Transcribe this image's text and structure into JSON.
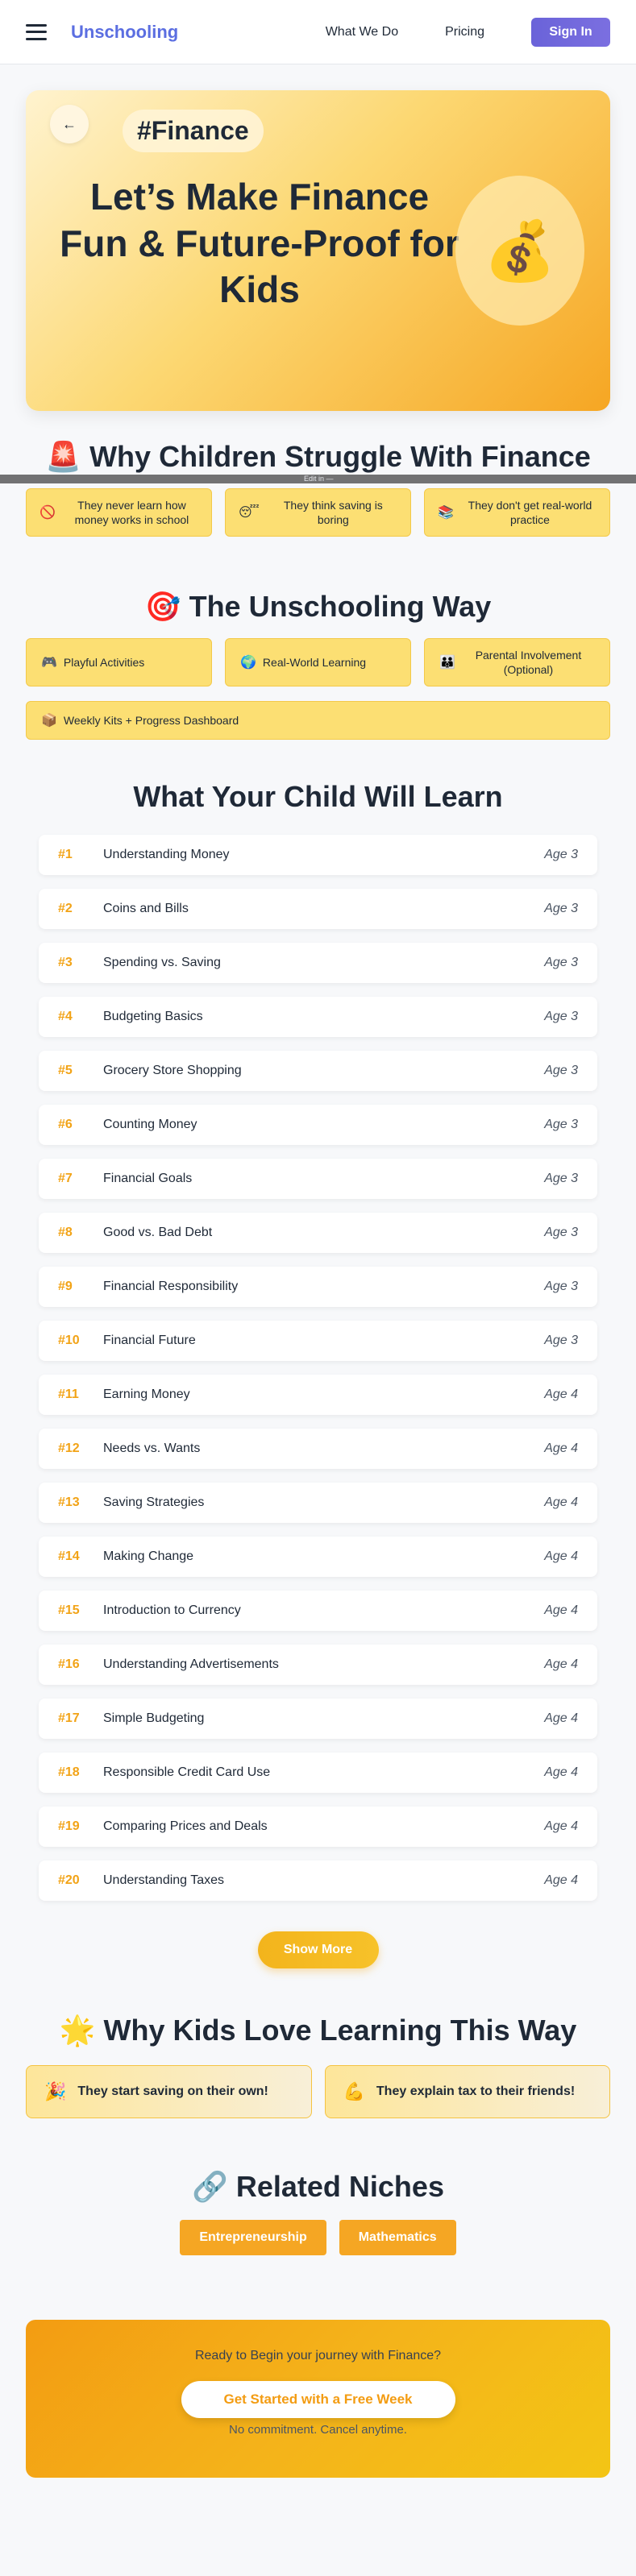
{
  "header": {
    "logo": "Unschooling",
    "nav": [
      "What We Do",
      "Pricing"
    ],
    "signin": "Sign In"
  },
  "hero": {
    "back_icon": "arrow-left-icon",
    "tag": "#Finance",
    "title": "Let’s Make Finance Fun & Future-Proof for Kids",
    "emoji": "💰"
  },
  "divider_text": "Edit in —",
  "struggle": {
    "title": "Why Children Struggle With Finance",
    "title_emoji": "🚨",
    "items": [
      {
        "icon": "🚫",
        "text": "They never learn how money works in school"
      },
      {
        "icon": "😴",
        "text": "They think saving is boring"
      },
      {
        "icon": "📚",
        "text": "They don't get real-world practice"
      }
    ]
  },
  "way": {
    "title": "The Unschooling Way",
    "title_emoji": "🎯",
    "items": [
      {
        "icon": "🎮",
        "text": "Playful Activities"
      },
      {
        "icon": "🌍",
        "text": "Real-World Learning"
      },
      {
        "icon": "👪",
        "text": "Parental Involvement (Optional)"
      },
      {
        "icon": "📦",
        "text": "Weekly Kits + Progress Dashboard"
      }
    ]
  },
  "learn": {
    "title": "What Your Child Will Learn",
    "items": [
      {
        "num": "#1",
        "name": "Understanding Money",
        "age": "Age 3"
      },
      {
        "num": "#2",
        "name": "Coins and Bills",
        "age": "Age 3"
      },
      {
        "num": "#3",
        "name": "Spending vs. Saving",
        "age": "Age 3"
      },
      {
        "num": "#4",
        "name": "Budgeting Basics",
        "age": "Age 3"
      },
      {
        "num": "#5",
        "name": "Grocery Store Shopping",
        "age": "Age 3"
      },
      {
        "num": "#6",
        "name": "Counting Money",
        "age": "Age 3"
      },
      {
        "num": "#7",
        "name": "Financial Goals",
        "age": "Age 3"
      },
      {
        "num": "#8",
        "name": "Good vs. Bad Debt",
        "age": "Age 3"
      },
      {
        "num": "#9",
        "name": "Financial Responsibility",
        "age": "Age 3"
      },
      {
        "num": "#10",
        "name": "Financial Future",
        "age": "Age 3"
      },
      {
        "num": "#11",
        "name": "Earning Money",
        "age": "Age 4"
      },
      {
        "num": "#12",
        "name": "Needs vs. Wants",
        "age": "Age 4"
      },
      {
        "num": "#13",
        "name": "Saving Strategies",
        "age": "Age 4"
      },
      {
        "num": "#14",
        "name": "Making Change",
        "age": "Age 4"
      },
      {
        "num": "#15",
        "name": "Introduction to Currency",
        "age": "Age 4"
      },
      {
        "num": "#16",
        "name": "Understanding Advertisements",
        "age": "Age 4"
      },
      {
        "num": "#17",
        "name": "Simple Budgeting",
        "age": "Age 4"
      },
      {
        "num": "#18",
        "name": "Responsible Credit Card Use",
        "age": "Age 4"
      },
      {
        "num": "#19",
        "name": "Comparing Prices and Deals",
        "age": "Age 4"
      },
      {
        "num": "#20",
        "name": "Understanding Taxes",
        "age": "Age 4"
      }
    ],
    "show_more": "Show More"
  },
  "love": {
    "title": "Why Kids Love Learning This Way",
    "title_emoji": "🌟",
    "items": [
      {
        "icon": "🎉",
        "text": "They start saving on their own!"
      },
      {
        "icon": "💪",
        "text": "They explain tax to their friends!"
      }
    ]
  },
  "niches": {
    "title": "Related Niches",
    "title_emoji": "🔗",
    "items": [
      "Entrepreneurship",
      "Mathematics"
    ]
  },
  "cta": {
    "text": "Ready to Begin your journey with Finance?",
    "button": "Get Started with a Free Week",
    "sub": "No commitment. Cancel anytime."
  },
  "colors": {
    "brand": "#5b6ee1",
    "accent": "#f5a623",
    "card_yellow": "#fcdf73"
  }
}
